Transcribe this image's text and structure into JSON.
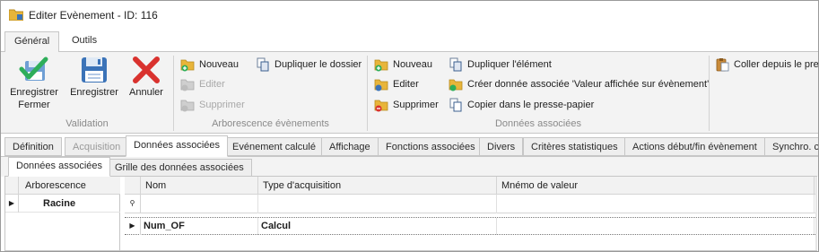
{
  "window": {
    "title": "Editer Evènement - ID: 116"
  },
  "ribbon_tabs": [
    "Général",
    "Outils"
  ],
  "ribbon": {
    "validation": {
      "label": "Validation",
      "buttons": [
        {
          "label_line1": "Enregistrer",
          "label_line2": "Fermer",
          "icon": "check-floppy-icon"
        },
        {
          "label_line1": "Enregistrer",
          "label_line2": "",
          "icon": "floppy-disk-icon"
        },
        {
          "label_line1": "Annuler",
          "label_line2": "",
          "icon": "cancel-x-icon"
        }
      ]
    },
    "arborescence": {
      "label": "Arborescence évènements",
      "buttons": [
        {
          "label": "Nouveau",
          "enabled": true,
          "icon": "folder-add-icon"
        },
        {
          "label": "Editer",
          "enabled": false,
          "icon": "folder-edit-icon"
        },
        {
          "label": "Supprimer",
          "enabled": false,
          "icon": "folder-delete-icon"
        },
        {
          "label": "Dupliquer le dossier",
          "enabled": true,
          "icon": "duplicate-icon"
        }
      ]
    },
    "donnees": {
      "label": "Données associées",
      "buttons": [
        {
          "label": "Nouveau",
          "enabled": true,
          "icon": "folder-add-icon"
        },
        {
          "label": "Editer",
          "enabled": true,
          "icon": "folder-edit-icon"
        },
        {
          "label": "Supprimer",
          "enabled": true,
          "icon": "folder-delete-icon"
        },
        {
          "label": "Dupliquer l'élément",
          "enabled": true,
          "icon": "duplicate-icon"
        },
        {
          "label": "Créer donnée associée 'Valeur affichée sur évènement'",
          "enabled": true,
          "icon": "folder-star-icon"
        },
        {
          "label": "Copier dans le presse-papier",
          "enabled": true,
          "icon": "copy-icon"
        },
        {
          "label": "Coller depuis le presse-papier",
          "enabled": true,
          "icon": "paste-icon"
        }
      ]
    }
  },
  "page_tabs": [
    {
      "label": "Définition",
      "state": "normal"
    },
    {
      "label": "Acquisition",
      "state": "disabled"
    },
    {
      "label": "Données associées",
      "state": "active"
    },
    {
      "label": "Evénement calculé",
      "state": "normal"
    },
    {
      "label": "Affichage",
      "state": "normal"
    },
    {
      "label": "Fonctions associées",
      "state": "normal"
    },
    {
      "label": "Divers",
      "state": "normal"
    },
    {
      "label": "Critères statistiques",
      "state": "normal"
    },
    {
      "label": "Actions début/fin évènement",
      "state": "normal"
    },
    {
      "label": "Synchro. c",
      "state": "normal"
    }
  ],
  "sub_tabs": [
    "Données associées",
    "Grille des données associées"
  ],
  "tree": {
    "header": "Arborescence",
    "rows": [
      "Racine"
    ]
  },
  "grid": {
    "columns": [
      "Nom",
      "Type d'acquisition",
      "Mnémo de valeur"
    ],
    "rows": [
      {
        "nom": "Num_OF",
        "type": "Calcul",
        "mnemo": ""
      }
    ]
  },
  "colors": {
    "ribbon_bg": "#f3f3f3",
    "border": "#c6c6c6",
    "disabled_text": "#a8a8a8",
    "folder_yellow": "#e8b53a",
    "save_blue": "#3b73b8",
    "cancel_red": "#d9322e",
    "check_green": "#2eae5a"
  }
}
